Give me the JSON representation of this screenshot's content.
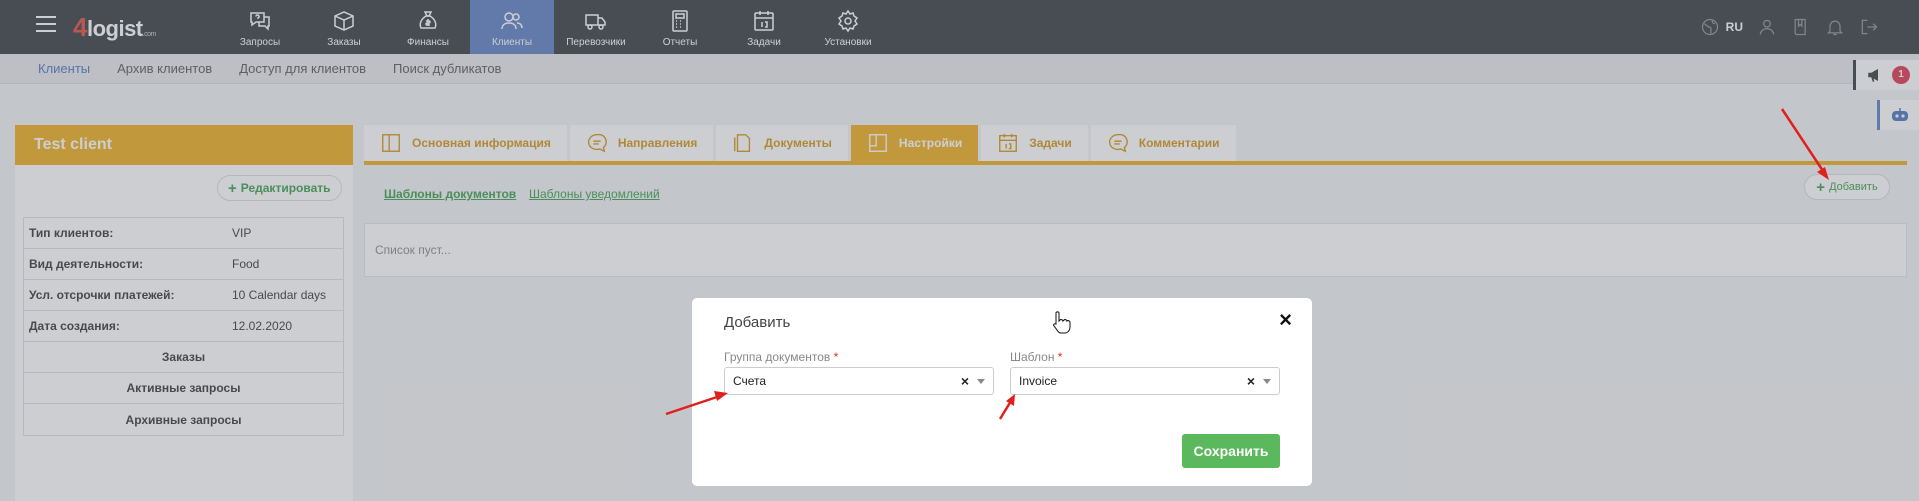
{
  "header": {
    "logo_four": "4",
    "logo_text": "logist",
    "logo_com": ".com",
    "nav": [
      {
        "label": "Запросы",
        "icon": "question-chat-icon"
      },
      {
        "label": "Заказы",
        "icon": "box-icon"
      },
      {
        "label": "Финансы",
        "icon": "money-bag-icon"
      },
      {
        "label": "Клиенты",
        "icon": "users-icon"
      },
      {
        "label": "Перевозчики",
        "icon": "truck-icon"
      },
      {
        "label": "Отчеты",
        "icon": "calculator-icon"
      },
      {
        "label": "Задачи",
        "icon": "calendar-icon"
      },
      {
        "label": "Установки",
        "icon": "gear-icon"
      }
    ],
    "active_nav": "Клиенты",
    "lang": "RU"
  },
  "subnav": {
    "items": [
      "Клиенты",
      "Архив клиентов",
      "Доступ для клиентов",
      "Поиск дубликатов"
    ]
  },
  "notifications": {
    "badge": "1"
  },
  "client": {
    "name": "Test client",
    "edit_label": "Редактировать",
    "fields": [
      {
        "key": "Тип клиентов:",
        "value": "VIP"
      },
      {
        "key": "Вид деятельности:",
        "value": "Food"
      },
      {
        "key": "Усл. отсрочки платежей:",
        "value": "10 Calendar days"
      },
      {
        "key": "Дата создания:",
        "value": "12.02.2020"
      }
    ],
    "links": [
      "Заказы",
      "Активные запросы",
      "Архивные запросы"
    ]
  },
  "tabs": [
    {
      "label": "Основная информация",
      "icon": "info-panel-icon"
    },
    {
      "label": "Направления",
      "icon": "chat-bubble-icon"
    },
    {
      "label": "Документы",
      "icon": "document-icon"
    },
    {
      "label": "Настройки",
      "icon": "settings-panel-icon"
    },
    {
      "label": "Задачи",
      "icon": "calendar-icon"
    },
    {
      "label": "Комментарии",
      "icon": "comment-icon"
    }
  ],
  "active_tab": "Настройки",
  "subtabs": [
    "Шаблоны документов",
    "Шаблоны уведомлений"
  ],
  "add_label": "Добавить",
  "empty_list": "Список пуст...",
  "modal": {
    "title": "Добавить",
    "group_label": "Группа документов",
    "group_value": "Счета",
    "template_label": "Шаблон",
    "template_value": "Invoice",
    "required_mark": "*",
    "clear_mark": "×",
    "close_mark": "×",
    "save_label": "Сохранить"
  },
  "colors": {
    "accent": "#f0ad1c",
    "nav_active": "#5b7fc2",
    "green": "#5cb85c",
    "topbar": "#353a40"
  }
}
